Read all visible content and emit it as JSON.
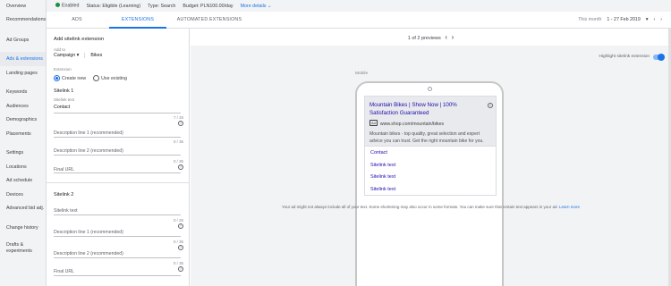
{
  "sidebar": {
    "items": [
      {
        "label": "Overview"
      },
      {
        "label": "Recommendations"
      },
      {
        "label": "Ad Groups"
      },
      {
        "label": "Ads & extensions"
      },
      {
        "label": "Landing pages"
      },
      {
        "label": "Keywords"
      },
      {
        "label": "Audiences"
      },
      {
        "label": "Demographics"
      },
      {
        "label": "Placements"
      },
      {
        "label": "Settings"
      },
      {
        "label": "Locations"
      },
      {
        "label": "Ad schedule"
      },
      {
        "label": "Devices"
      },
      {
        "label": "Advanced bid adj."
      },
      {
        "label": "Change history"
      },
      {
        "label": "Drafts &"
      },
      {
        "label": "experiments"
      }
    ]
  },
  "topbar": {
    "enabled": "Enabled",
    "status": "Status: Eligible (Learning)",
    "type": "Type: Search",
    "budget": "Budget: PLN100.00/day",
    "more": "More details"
  },
  "tabs": [
    "ADS",
    "EXTENSIONS",
    "AUTOMATED EXTENSIONS"
  ],
  "date": {
    "label": "This month",
    "value": "1 - 27 Feb 2019"
  },
  "form": {
    "title": "Add sitelink extension",
    "add_to_label": "Add to",
    "add_to_value": "Campaign",
    "add_to_target": "Bikes",
    "extension_label": "Extension",
    "opt_create": "Create new",
    "opt_existing": "Use existing",
    "sitelink1": "Sitelink 1",
    "sitelink_text_label": "Sitelink text",
    "sitelink1_text": "Contact",
    "count_text": "7 / 25",
    "desc1": "Description line 1 (recommended)",
    "count_desc1": "0 / 35",
    "desc2": "Description line 2 (recommended)",
    "count_desc2": "0 / 35",
    "final_url": "Final URL",
    "sitelink2": "Sitelink 2",
    "sitelink2_text_label": "Sitelink text",
    "count_text2": "0 / 25",
    "desc1b": "Description line 1 (recommended)",
    "count_desc1b": "0 / 35",
    "desc2b": "Description line 2 (recommended)",
    "count_desc2b": "0 / 35",
    "final_url_b": "Final URL"
  },
  "preview": {
    "pager": "1 of 2 previews",
    "highlight_label": "Highlight sitelink extension",
    "device": "Mobile",
    "ad_headline": "Mountain Bikes | Show Now | 100% Satisfaction Guaranteed",
    "ad_badge": "Ad",
    "ad_url": "www.shop.com/mountain/bikes",
    "ad_desc": "Mountain bikes - top quality, great selection and expert advice you can trust. Get the right mountain bike for you.",
    "sitelinks": [
      "Contact",
      "Sitelink text",
      "Sitelink text",
      "Sitelink text"
    ],
    "note": "Your ad might not always include all of your text. Some shortening may also occur in some formats. You can make sure that certain text appears in your ad.",
    "learn_more": "Learn more"
  }
}
